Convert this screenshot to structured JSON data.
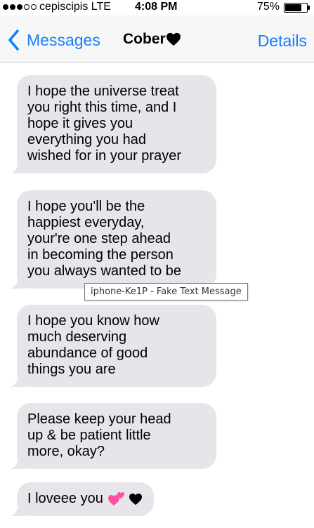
{
  "status_bar": {
    "carrier": "cepiscipis  LTE",
    "time": "4:08 PM",
    "battery": "75%",
    "battery_level": 0.75,
    "signal_bars_filled": 3,
    "signal_bars_total": 5
  },
  "nav": {
    "back_label": "Messages",
    "contact_name": "Cober",
    "details_label": "Details"
  },
  "messages": [
    {
      "text": "I hope the universe treat\nyou right this time, and I\nhope it gives you\neverything you had\nwished for in your prayer"
    },
    {
      "text": "I hope you'll be the\nhappiest everyday,\nyour're one step ahead\nin becoming the person\nyou always wanted to be"
    },
    {
      "text": "I hope you know how\nmuch deserving\nabundance of good\nthings you are"
    },
    {
      "text": "Please keep your head\nup & be patient little\nmore, okay?"
    },
    {
      "text": "I loveee you",
      "emojis": [
        "two-hearts",
        "black-heart"
      ]
    }
  ],
  "tooltip": {
    "text": "iphone-Ke1P - Fake Text Message"
  },
  "colors": {
    "accent": "#157efb",
    "bubble": "#e5e5ea",
    "nav_background": "#f7f7f7",
    "emoji_pink": "#ff4fa3"
  }
}
